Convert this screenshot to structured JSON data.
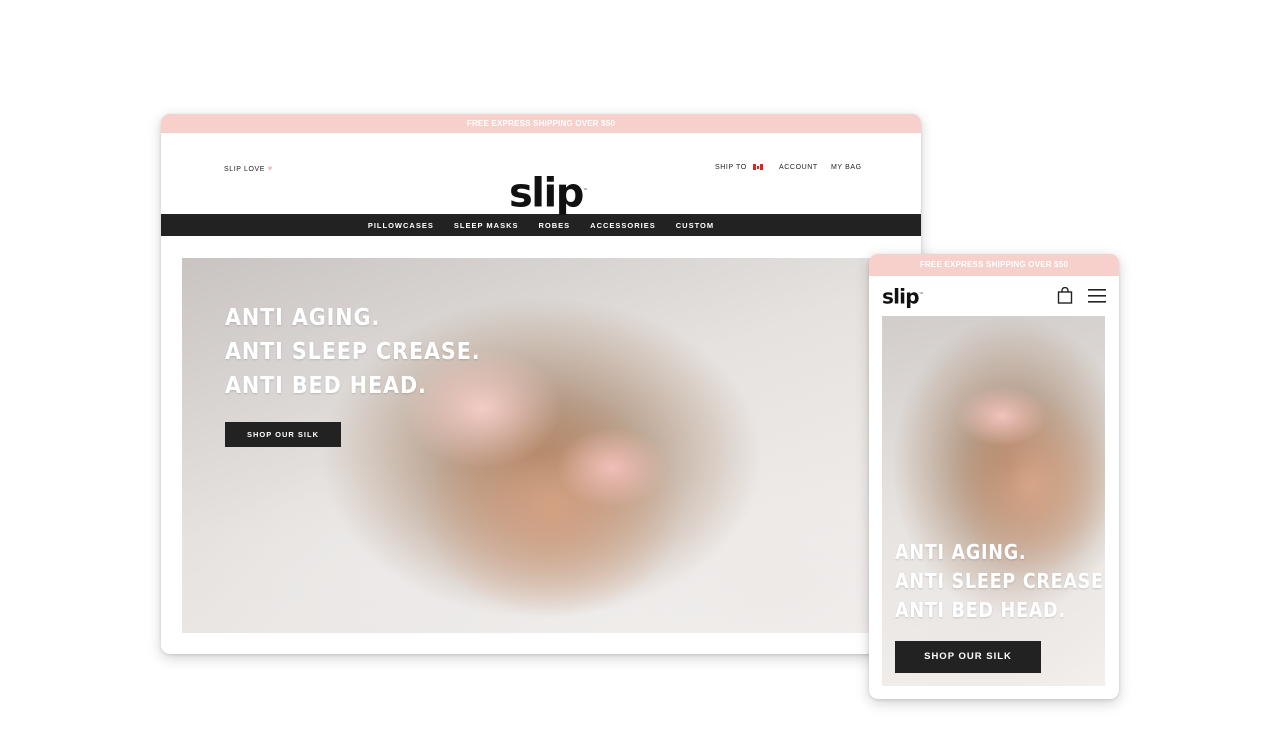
{
  "promo_text": "FREE EXPRESS SHIPPING OVER $50",
  "brand": "slip",
  "trademark": "™",
  "desktop": {
    "utility": {
      "slip_love": "SLIP LOVE",
      "heart": "♥",
      "ship_to": "SHIP TO",
      "account": "ACCOUNT",
      "my_bag": "MY BAG"
    },
    "nav": [
      "PILLOWCASES",
      "SLEEP MASKS",
      "ROBES",
      "ACCESSORIES",
      "CUSTOM"
    ]
  },
  "hero": {
    "lines": [
      "ANTI AGING.",
      "ANTI SLEEP CREASE.",
      "ANTI BED HEAD."
    ],
    "cta": "SHOP OUR SILK"
  },
  "mobile": {
    "icons": [
      "bag-icon",
      "menu-icon"
    ]
  },
  "colors": {
    "promo_bg": "#f7cfcb",
    "nav_bg": "#222222",
    "cta_bg": "#222222"
  }
}
